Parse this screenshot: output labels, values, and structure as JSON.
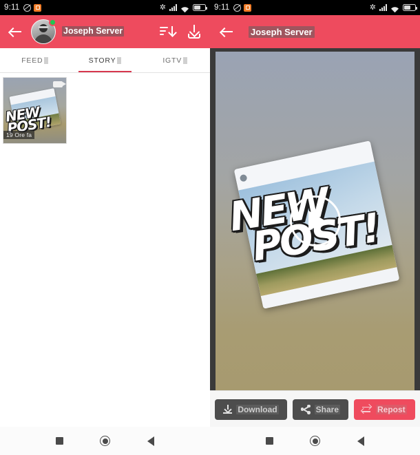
{
  "status_bar": {
    "time": "9:11",
    "icons": [
      "dnd-icon",
      "app-notification-icon",
      "bluetooth-icon",
      "signal-icon",
      "wifi-icon",
      "battery-icon"
    ],
    "bluetooth_glyph": "✲"
  },
  "left_panel": {
    "app_bar": {
      "back_label": "Back",
      "account_name": "Joseph Server",
      "account_username": "",
      "sort_label": "Sort",
      "download_label": "Download All"
    },
    "tabs": [
      {
        "label": "FEED",
        "active": false
      },
      {
        "label": "STORY",
        "active": true
      },
      {
        "label": "IGTV",
        "active": false
      }
    ],
    "items": [
      {
        "date": "19 Ore fa",
        "overlay_line1": "NEW",
        "overlay_line2": "POST!",
        "is_video": true
      }
    ]
  },
  "right_panel": {
    "app_bar": {
      "back_label": "Back",
      "title": "Joseph Server"
    },
    "media": {
      "card_username": "",
      "card_caption": "",
      "overlay_line1": "NEW",
      "overlay_line2": "POST!",
      "play_label": "Play"
    },
    "actions": [
      {
        "label": "Download",
        "icon": "download-icon",
        "style": "dark"
      },
      {
        "label": "Share",
        "icon": "share-icon",
        "style": "dark"
      },
      {
        "label": "Repost",
        "icon": "repost-icon",
        "style": "red"
      }
    ]
  },
  "nav_bar": {
    "recents_label": "Recents",
    "home_label": "Home",
    "back_label": "Back"
  },
  "colors": {
    "accent": "#ee4b5e",
    "tab_indicator": "#d7374e",
    "dark_button": "#4d4d4d",
    "viewer_frame": "#3a3a3a",
    "online_dot": "#23c552"
  }
}
